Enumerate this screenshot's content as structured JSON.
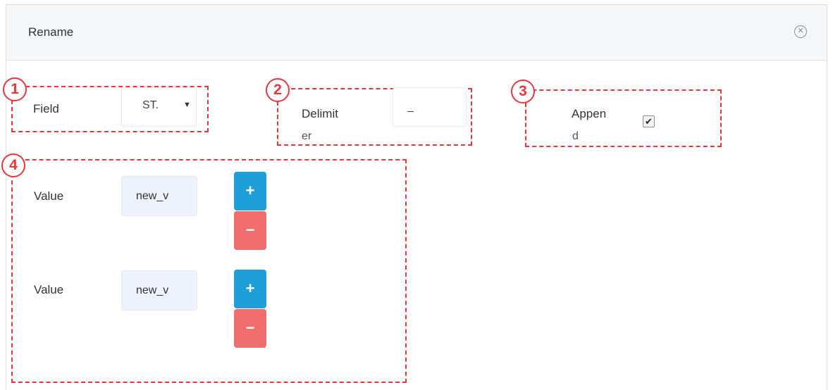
{
  "dialog": {
    "title": "Rename",
    "close_icon": "circle-x-icon",
    "close_glyph": "✕"
  },
  "markers": [
    "1",
    "2",
    "3",
    "4"
  ],
  "field": {
    "label": "Field",
    "selected": "ST.",
    "caret": "▼"
  },
  "delimiter": {
    "label_line1": "Delimit",
    "label_line2": "er",
    "value": "_"
  },
  "append": {
    "label_line1": "Appen",
    "label_line2": "d",
    "checked": true,
    "check_glyph": "✔"
  },
  "values": [
    {
      "label": "Value",
      "value": "new_v",
      "add_label": "+",
      "remove_label": "−"
    },
    {
      "label": "Value",
      "value": "new_v",
      "add_label": "+",
      "remove_label": "−"
    }
  ],
  "colors": {
    "annotation": "#e8363c",
    "add_button": "#1e9fd8",
    "remove_button": "#f16e6e",
    "value_input_bg": "#eef2fd"
  }
}
